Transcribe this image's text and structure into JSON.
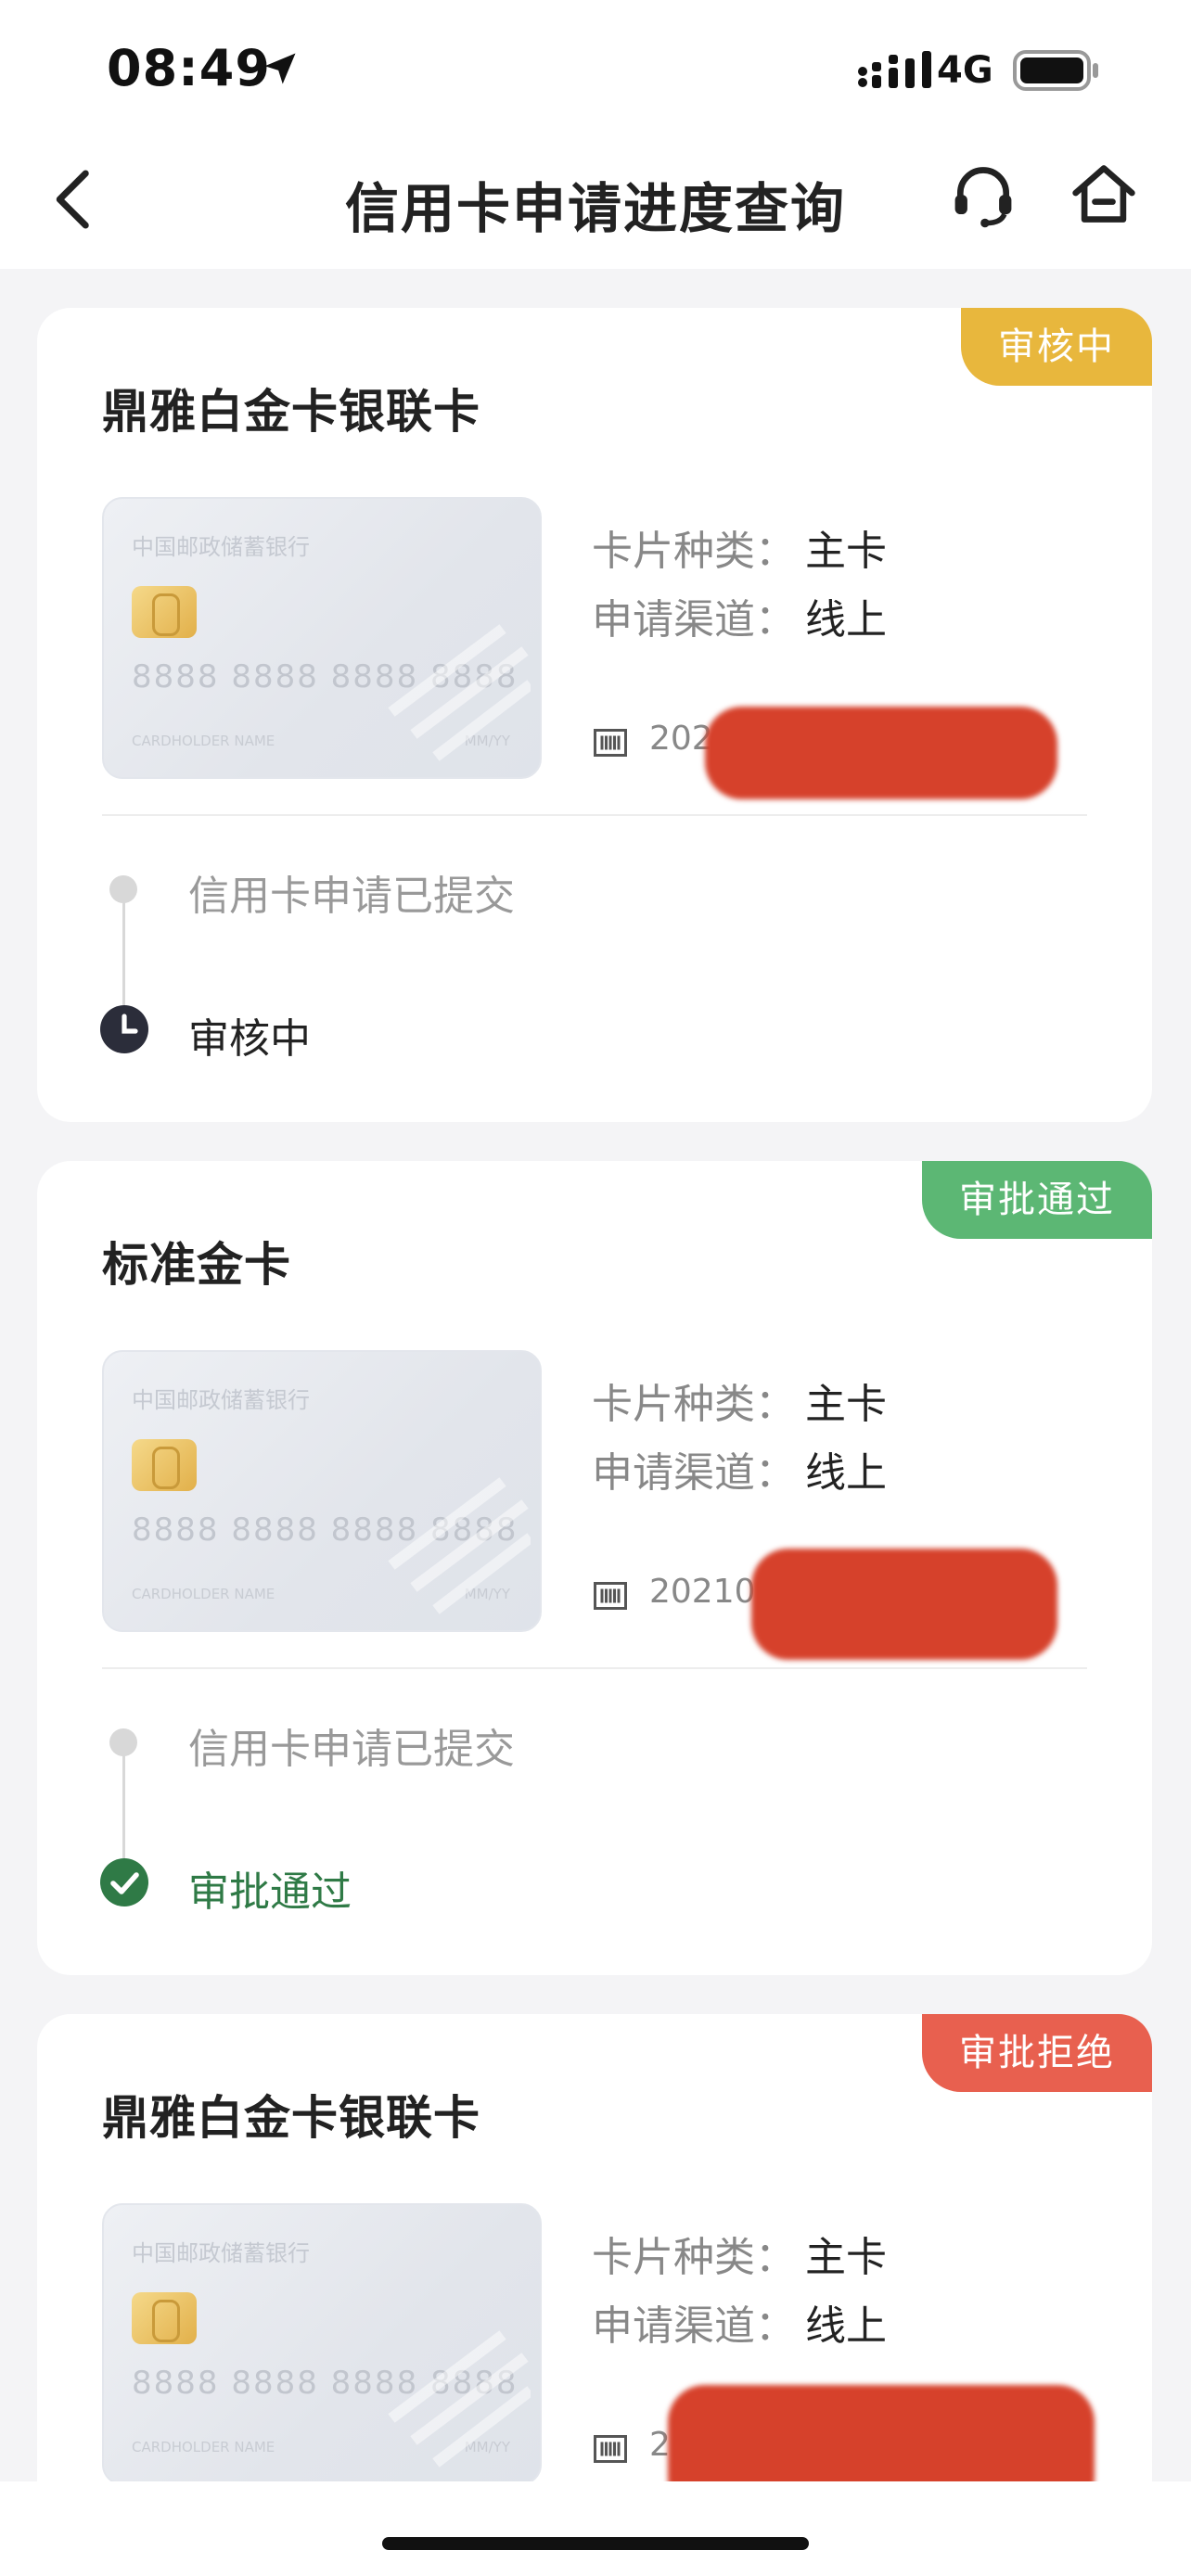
{
  "status_bar": {
    "time": "08:49",
    "network": "4G"
  },
  "nav": {
    "title": "信用卡申请进度查询"
  },
  "applications": [
    {
      "badge": "审核中",
      "badge_color": "#e8b73d",
      "card_name": "鼎雅白金卡银联卡",
      "card_face": {
        "bank": "中国邮政储蓄银行",
        "number": "8888 8888 8888 8888",
        "holder": "CARDHOLDER NAME",
        "expiry": "MM/YY"
      },
      "card_type_label": "卡片种类：",
      "card_type": "主卡",
      "channel_label": "申请渠道：",
      "channel": "线上",
      "app_no": "202",
      "step1": "信用卡申请已提交",
      "step2": "审核中",
      "step2_color": "#222222",
      "status_icon": "clock-icon"
    },
    {
      "badge": "审批通过",
      "badge_color": "#5cb774",
      "card_name": "标准金卡",
      "card_face": {
        "bank": "中国邮政储蓄银行",
        "number": "8888 8888 8888 8888",
        "holder": "CARDHOLDER NAME",
        "expiry": "MM/YY"
      },
      "card_type_label": "卡片种类：",
      "card_type": "主卡",
      "channel_label": "申请渠道：",
      "channel": "线上",
      "app_no": "202107",
      "step1": "信用卡申请已提交",
      "step2": "审批通过",
      "step2_color": "#2f7a46",
      "status_icon": "check-icon"
    },
    {
      "badge": "审批拒绝",
      "badge_color": "#e8604f",
      "card_name": "鼎雅白金卡银联卡",
      "card_face": {
        "bank": "中国邮政储蓄银行",
        "number": "8888 8888 8888 8888",
        "holder": "CARDHOLDER NAME",
        "expiry": "MM/YY"
      },
      "card_type_label": "卡片种类：",
      "card_type": "主卡",
      "channel_label": "申请渠道：",
      "channel": "线上",
      "app_no": "2"
    }
  ]
}
